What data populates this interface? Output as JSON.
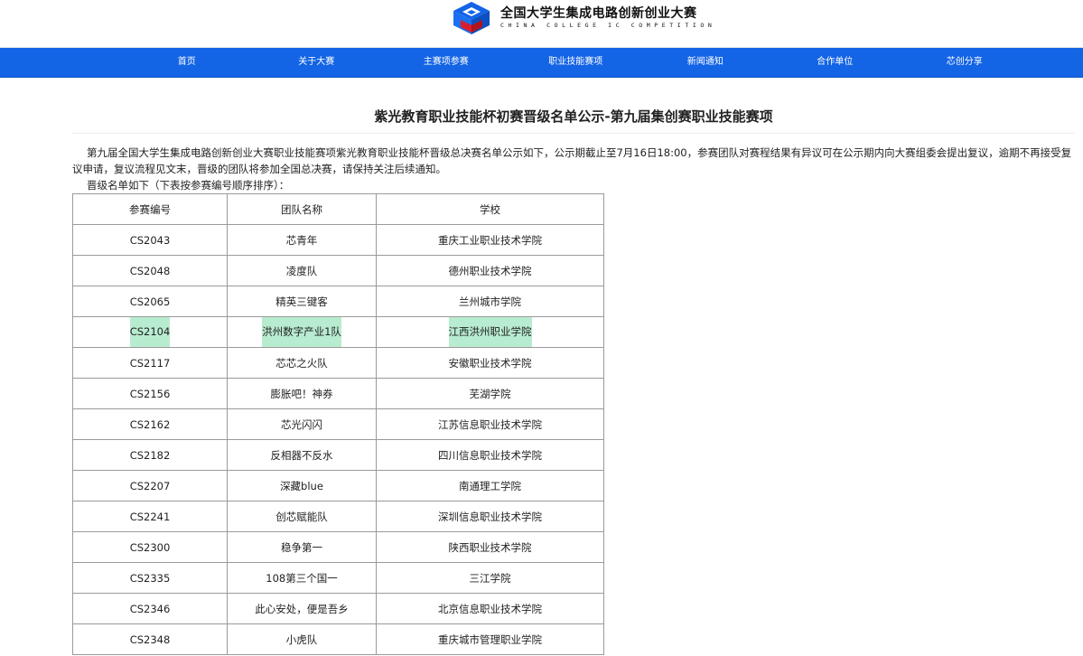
{
  "header": {
    "logo_cn": "全国大学生集成电路创新创业大赛",
    "logo_en": "CHINA COLLEGE IC COMPETITION",
    "colors": {
      "logo_blue": "#1464e6",
      "logo_red": "#d81e2c",
      "nav_bg": "#1464e6"
    }
  },
  "nav": {
    "items": [
      "首页",
      "关于大赛",
      "主赛项参赛",
      "职业技能赛项",
      "新闻通知",
      "合作单位",
      "芯创分享"
    ]
  },
  "article": {
    "title": "紫光教育职业技能杯初赛晋级名单公示-第九届集创赛职业技能赛项",
    "intro": "第九届全国大学生集成电路创新创业大赛职业技能赛项紫光教育职业技能杯晋级总决赛名单公示如下，公示期截止至7月16日18:00，参赛团队对赛程结果有异议可在公示期内向大赛组委会提出复议，逾期不再接受复议申请，复议流程见文末，晋级的团队将参加全国总决赛，请保持关注后续通知。",
    "subline": "晋级名单如下（下表按参赛编号顺序排序）："
  },
  "table": {
    "headers": [
      "参赛编号",
      "团队名称",
      "学校"
    ],
    "highlight_color": "#b8ecd0",
    "rows": [
      {
        "id": "CS2043",
        "team": "芯青年",
        "school": "重庆工业职业技术学院",
        "highlight": false
      },
      {
        "id": "CS2048",
        "team": "凌度队",
        "school": "德州职业技术学院",
        "highlight": false
      },
      {
        "id": "CS2065",
        "team": "精英三键客",
        "school": "兰州城市学院",
        "highlight": false
      },
      {
        "id": "CS2104",
        "team": "洪州数字产业1队",
        "school": "江西洪州职业学院",
        "highlight": true
      },
      {
        "id": "CS2117",
        "team": "芯芯之火队",
        "school": "安徽职业技术学院",
        "highlight": false
      },
      {
        "id": "CS2156",
        "team": "膨胀吧！神券",
        "school": "芜湖学院",
        "highlight": false
      },
      {
        "id": "CS2162",
        "team": "芯光闪闪",
        "school": "江苏信息职业技术学院",
        "highlight": false
      },
      {
        "id": "CS2182",
        "team": "反相器不反水",
        "school": "四川信息职业技术学院",
        "highlight": false
      },
      {
        "id": "CS2207",
        "team": "深藏blue",
        "school": "南通理工学院",
        "highlight": false
      },
      {
        "id": "CS2241",
        "team": "创芯赋能队",
        "school": "深圳信息职业技术学院",
        "highlight": false
      },
      {
        "id": "CS2300",
        "team": "稳争第一",
        "school": "陕西职业技术学院",
        "highlight": false
      },
      {
        "id": "CS2335",
        "team": "108第三个国一",
        "school": "三江学院",
        "highlight": false
      },
      {
        "id": "CS2346",
        "team": "此心安处，便是吾乡",
        "school": "北京信息职业技术学院",
        "highlight": false
      },
      {
        "id": "CS2348",
        "team": "小虎队",
        "school": "重庆城市管理职业学院",
        "highlight": false
      }
    ]
  }
}
